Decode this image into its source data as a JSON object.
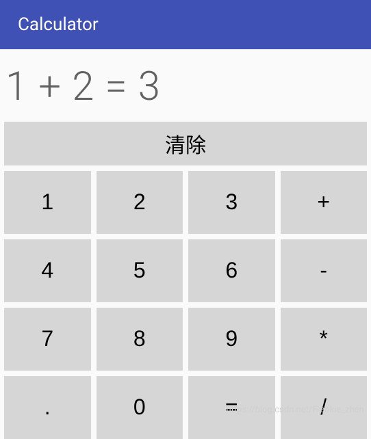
{
  "header": {
    "title": "Calculator"
  },
  "display": {
    "expression": "1 + 2 = 3"
  },
  "clear": {
    "label": "清除"
  },
  "keypad": {
    "rows": [
      [
        "1",
        "2",
        "3",
        "+"
      ],
      [
        "4",
        "5",
        "6",
        "-"
      ],
      [
        "7",
        "8",
        "9",
        "*"
      ],
      [
        ".",
        "0",
        "=",
        "/"
      ]
    ]
  },
  "watermark": "https://blog.csdn.net/Frankie_zhen"
}
